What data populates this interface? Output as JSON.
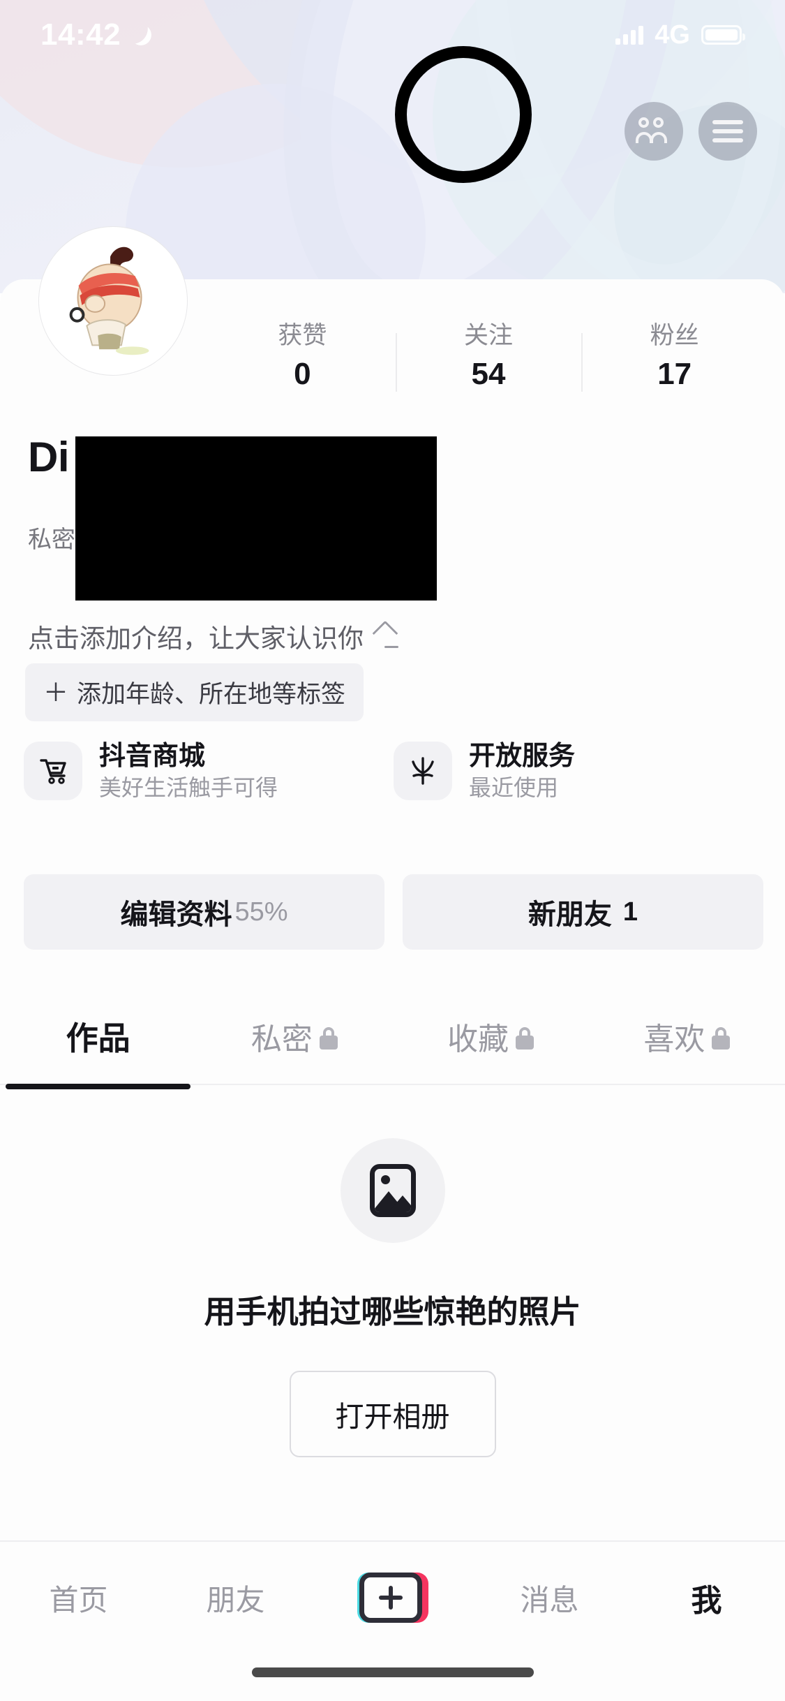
{
  "status_bar": {
    "time": "14:42",
    "dnd_icon": "moon-icon",
    "signal_icon": "signal-bars-icon",
    "network": "4G",
    "battery_icon": "battery-icon"
  },
  "header": {
    "find_friends_icon": "find-friends-icon",
    "menu_icon": "hamburger-menu-icon",
    "annotation": "highlight-circle-on-menu-button"
  },
  "profile": {
    "avatar_icon": "user-avatar-cartoon",
    "display_name": "Di",
    "handle_prefix": "私密",
    "redacted": true,
    "bio_placeholder": "点击添加介绍，让大家认识你",
    "bio_edit_icon": "pencil-icon",
    "tag_add_plus": "＋",
    "tag_add_label": "添加年龄、所在地等标签"
  },
  "stats": [
    {
      "label": "获赞",
      "value": "0"
    },
    {
      "label": "关注",
      "value": "54"
    },
    {
      "label": "粉丝",
      "value": "17"
    }
  ],
  "services": [
    {
      "icon": "shopping-cart-icon",
      "title": "抖音商城",
      "subtitle": "美好生活触手可得"
    },
    {
      "icon": "open-service-star-icon",
      "title": "开放服务",
      "subtitle": "最近使用"
    }
  ],
  "actions": [
    {
      "label": "编辑资料",
      "badge": "55%"
    },
    {
      "label": "新朋友",
      "count": "1"
    }
  ],
  "tabs": [
    {
      "label": "作品",
      "locked": false,
      "active": true
    },
    {
      "label": "私密",
      "locked": true,
      "active": false
    },
    {
      "label": "收藏",
      "locked": true,
      "active": false
    },
    {
      "label": "喜欢",
      "locked": true,
      "active": false
    }
  ],
  "empty_state": {
    "icon": "image-placeholder-icon",
    "title": "用手机拍过哪些惊艳的照片",
    "button_label": "打开相册"
  },
  "bottom_nav": [
    {
      "label": "首页",
      "active": false
    },
    {
      "label": "朋友",
      "active": false
    },
    {
      "label": "",
      "icon": "create-plus-button",
      "active": false
    },
    {
      "label": "消息",
      "active": false
    },
    {
      "label": "我",
      "active": true
    }
  ],
  "colors": {
    "accent_cyan": "#4ddbe4",
    "accent_pink": "#f5345f",
    "text_primary": "#15151a",
    "text_muted": "#9a9aa2",
    "chip_bg": "#f1f1f4",
    "redaction": "#000000"
  }
}
